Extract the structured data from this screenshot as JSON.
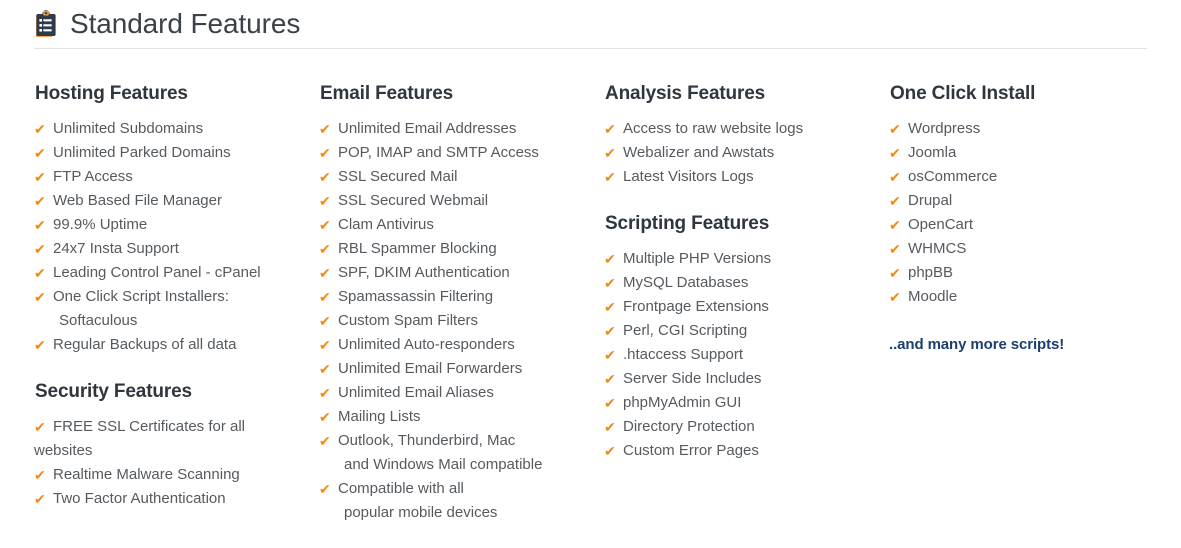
{
  "header": {
    "title": "Standard Features",
    "icon": "clipboard-list-icon"
  },
  "colors": {
    "check": "#f28a12",
    "heading": "#2f363d",
    "body": "#555a5f",
    "footnote": "#1c3f6e",
    "rule": "#e2e2e2",
    "background": "#ffffff"
  },
  "check_glyph": "✔",
  "columns": [
    {
      "groups": [
        {
          "title": "Hosting Features",
          "items": [
            {
              "text": "Unlimited Subdomains"
            },
            {
              "text": "Unlimited Parked Domains"
            },
            {
              "text": "FTP Access"
            },
            {
              "text": "Web Based File Manager"
            },
            {
              "text": "99.9% Uptime"
            },
            {
              "text": "24x7 Insta Support"
            },
            {
              "text": "Leading Control Panel - cPanel"
            },
            {
              "text": "One Click Script Installers:",
              "cont": "Softaculous",
              "wrap": "indent"
            },
            {
              "text": "Regular Backups of all data"
            }
          ]
        },
        {
          "title": "Security Features",
          "items": [
            {
              "text": "FREE SSL Certificates for all",
              "cont": "websites",
              "wrap": "flush"
            },
            {
              "text": "Realtime Malware Scanning"
            },
            {
              "text": "Two Factor Authentication"
            }
          ]
        }
      ]
    },
    {
      "groups": [
        {
          "title": "Email Features",
          "items": [
            {
              "text": "Unlimited Email Addresses"
            },
            {
              "text": "POP, IMAP and SMTP Access"
            },
            {
              "text": "SSL Secured Mail"
            },
            {
              "text": "SSL Secured Webmail"
            },
            {
              "text": "Clam Antivirus"
            },
            {
              "text": "RBL Spammer Blocking"
            },
            {
              "text": "SPF, DKIM Authentication"
            },
            {
              "text": "Spamassassin Filtering"
            },
            {
              "text": "Custom Spam Filters"
            },
            {
              "text": "Unlimited Auto-responders"
            },
            {
              "text": "Unlimited Email Forwarders"
            },
            {
              "text": "Unlimited Email Aliases"
            },
            {
              "text": "Mailing Lists"
            },
            {
              "text": "Outlook, Thunderbird, Mac",
              "cont": "and Windows Mail compatible",
              "wrap": "indent"
            },
            {
              "text": "Compatible with all",
              "cont": "popular mobile devices",
              "wrap": "indent"
            }
          ]
        }
      ]
    },
    {
      "groups": [
        {
          "title": "Analysis Features",
          "items": [
            {
              "text": "Access to raw website logs"
            },
            {
              "text": "Webalizer and Awstats"
            },
            {
              "text": "Latest Visitors Logs"
            }
          ]
        },
        {
          "title": "Scripting Features",
          "items": [
            {
              "text": "Multiple PHP Versions"
            },
            {
              "text": "MySQL Databases"
            },
            {
              "text": "Frontpage Extensions"
            },
            {
              "text": "Perl, CGI Scripting"
            },
            {
              "text": ".htaccess Support"
            },
            {
              "text": "Server Side Includes"
            },
            {
              "text": "phpMyAdmin GUI"
            },
            {
              "text": "Directory Protection"
            },
            {
              "text": "Custom Error Pages"
            }
          ]
        }
      ]
    },
    {
      "groups": [
        {
          "title": "One Click Install",
          "items": [
            {
              "text": "Wordpress"
            },
            {
              "text": "Joomla"
            },
            {
              "text": "osCommerce"
            },
            {
              "text": "Drupal"
            },
            {
              "text": "OpenCart"
            },
            {
              "text": "WHMCS"
            },
            {
              "text": "phpBB"
            },
            {
              "text": "Moodle"
            }
          ],
          "footnote": "..and many more scripts!"
        }
      ]
    }
  ]
}
